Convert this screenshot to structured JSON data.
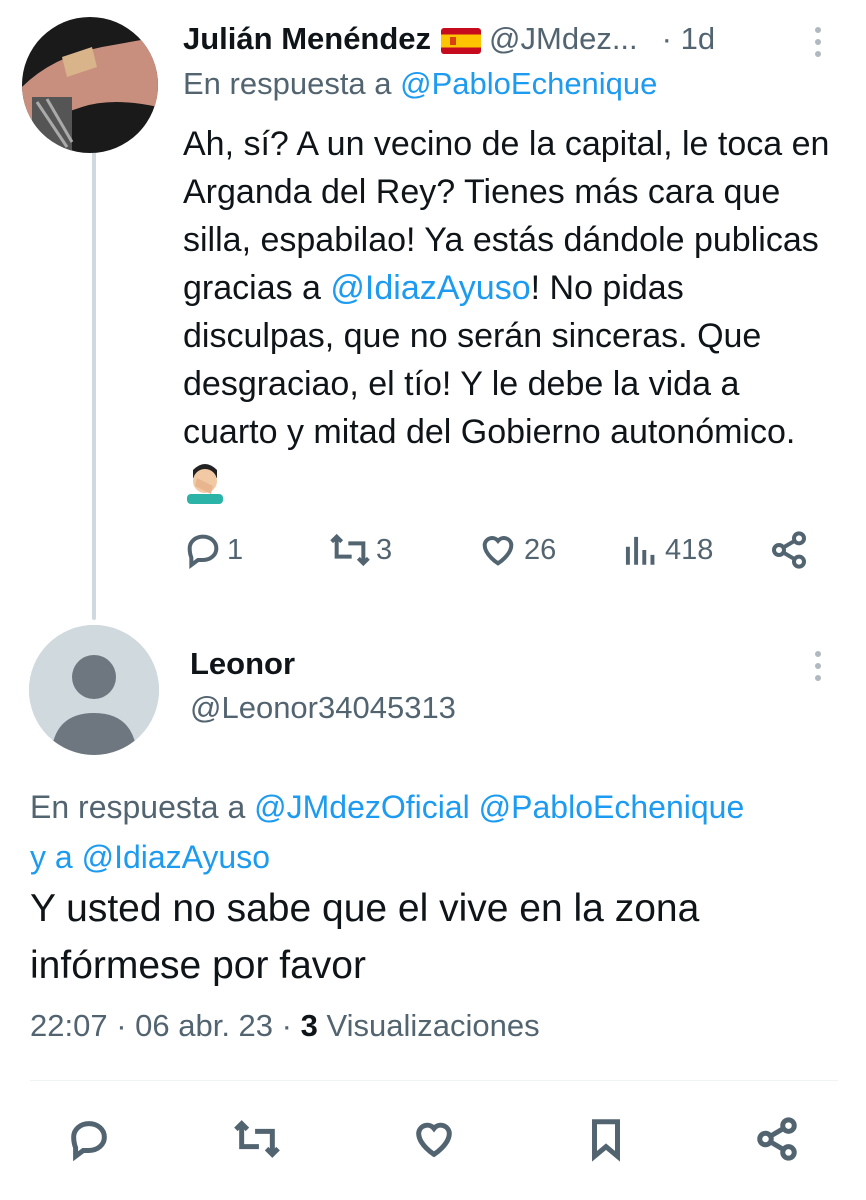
{
  "tweet1": {
    "name": "Julián Menéndez",
    "handle": "@JMdez...",
    "time": "· 1d",
    "reply_prefix": "En respuesta a ",
    "reply_to": "@PabloEchenique",
    "text_part1": "Ah, sí? A un vecino de la capital, le toca en Arganda del Rey? Tienes más cara que silla, espabilao! Ya estás dándole publicas gracias a ",
    "text_mention": "@IdiazAyuso",
    "text_part2": "! No pidas disculpas, que no serán sinceras. Que desgraciao, el tío! Y le debe la vida a cuarto y mitad del Gobierno autonómico. ",
    "actions": {
      "replies": "1",
      "retweets": "3",
      "likes": "26",
      "views": "418"
    },
    "icons": [
      "reply-icon",
      "retweet-icon",
      "like-icon",
      "views-icon",
      "share-icon",
      "more-icon"
    ]
  },
  "tweet2": {
    "name": "Leonor",
    "handle": "@Leonor34045313",
    "reply_prefix": "En respuesta a ",
    "reply_to_1": "@JMdezOficial",
    "reply_to_2": "@PabloEchenique",
    "reply_and": "y a ",
    "reply_to_3": "@IdiazAyuso",
    "text": "Y usted no sabe que el vive en la zona infórmese por favor",
    "time": "22:07",
    "date": "06 abr. 23",
    "views_count": "3",
    "views_label": "Visualizaciones",
    "icons": [
      "reply-icon",
      "retweet-icon",
      "like-icon",
      "bookmark-icon",
      "share-icon"
    ]
  },
  "colors": {
    "link": "#1d9bf0",
    "muted": "#536471",
    "text": "#0f1419",
    "thread_line": "#cfd9de"
  }
}
